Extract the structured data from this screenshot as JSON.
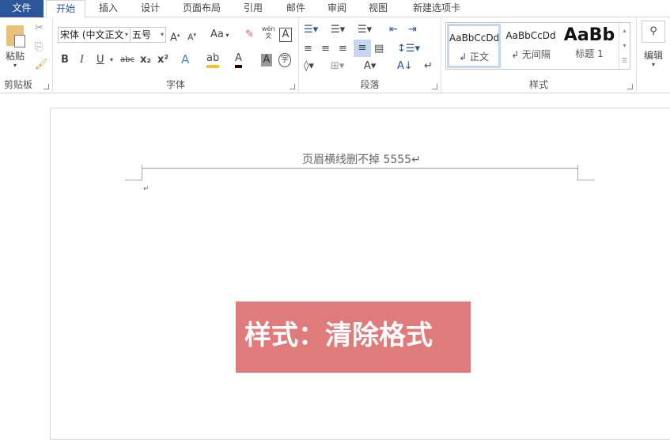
{
  "tabs": [
    "文件",
    "开始",
    "插入",
    "设计",
    "页面布局",
    "引用",
    "邮件",
    "审阅",
    "视图",
    "新建选项卡"
  ],
  "clipboard": {
    "paste": "粘贴",
    "label": "剪贴板"
  },
  "font": {
    "name": "宋体 (中文正文",
    "size": "五号",
    "label": "字体",
    "case": "Aa",
    "bold": "B",
    "italic": "I",
    "underline": "U",
    "strike": "abc",
    "sub": "x₂",
    "sup": "x²",
    "phonetic": "wén",
    "phonetic2": "文"
  },
  "paragraph": {
    "label": "段落"
  },
  "styles": {
    "label": "样式",
    "items": [
      {
        "sample": "AaBbCcDd",
        "name": "↲ 正文"
      },
      {
        "sample": "AaBbCcDd",
        "name": "↲ 无间隔"
      },
      {
        "sample": "AaBb",
        "name": "标题 1"
      }
    ]
  },
  "editing": {
    "label": "编辑"
  },
  "document": {
    "header_text": "页眉横线删不掉 5555↵",
    "para_mark": "↵",
    "banner": "样式：清除格式"
  }
}
